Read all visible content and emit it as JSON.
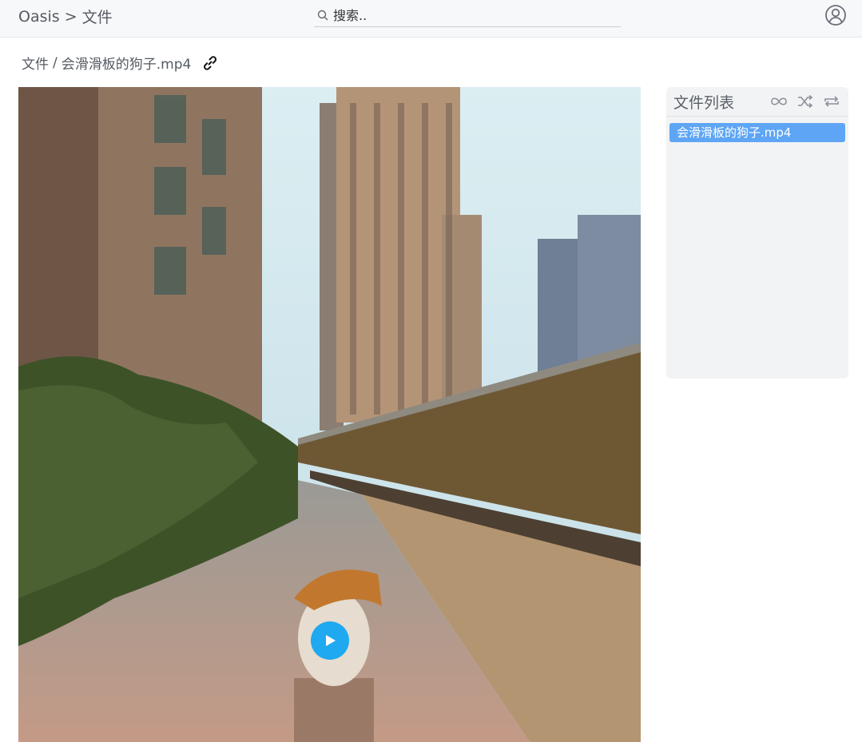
{
  "header": {
    "app_name": "Oasis",
    "separator": ">",
    "section": "文件",
    "search_placeholder": "搜索..",
    "search_value": ""
  },
  "path": {
    "root": "文件",
    "separator": "/",
    "file": "会滑滑板的狗子.mp4"
  },
  "playlist": {
    "title": "文件列表",
    "items": [
      "会滑滑板的狗子.mp4"
    ],
    "selected_index": 0
  },
  "colors": {
    "accent": "#1ea9f0",
    "selected_item": "#5ea5f5"
  },
  "icons": [
    "search-icon",
    "user-avatar-icon",
    "link-icon",
    "infinite-loop-icon",
    "shuffle-icon",
    "repeat-icon",
    "play-icon"
  ]
}
